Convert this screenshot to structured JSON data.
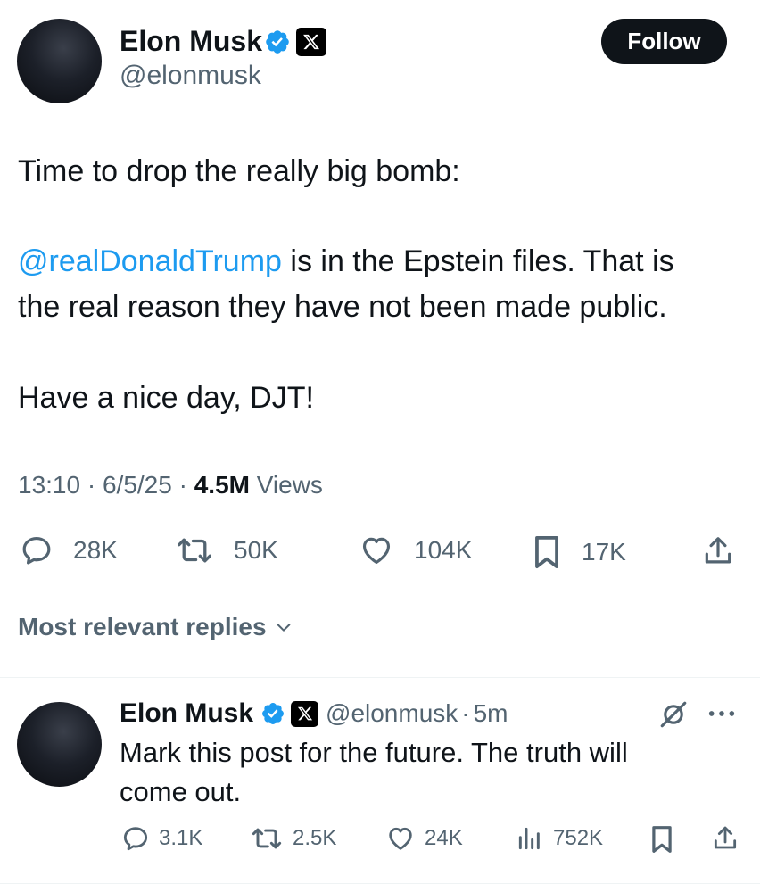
{
  "main_post": {
    "author_name": "Elon Musk",
    "author_handle": "@elonmusk",
    "follow_label": "Follow",
    "text_line_1": "Time to drop the really big bomb:",
    "mention": "@realDonaldTrump",
    "text_line_2_rest": " is in the Epstein files. That is",
    "text_line_3": "the real reason they have not been made public.",
    "text_line_4": "Have a nice day, DJT!",
    "time": "13:10",
    "sep_1": "·",
    "date": "6/5/25",
    "sep_2": "·",
    "views_count": "4.5M",
    "views_label": "Views",
    "replies": "28K",
    "reposts": "50K",
    "likes": "104K",
    "bookmarks": "17K"
  },
  "replies_section": {
    "sort_label": "Most relevant replies"
  },
  "reply": {
    "author_name": "Elon Musk",
    "author_handle": "@elonmusk",
    "sep": "·",
    "age": "5m",
    "text_line_1": "Mark this post for the future. The truth will",
    "text_line_2": "come out.",
    "replies": "3.1K",
    "reposts": "2.5K",
    "likes": "24K",
    "views": "752K"
  },
  "icons": {
    "verified": "verified-badge-icon",
    "x_logo": "x-logo-icon",
    "reply": "reply-icon",
    "repost": "repost-icon",
    "like": "like-icon",
    "bookmark": "bookmark-icon",
    "share": "share-icon",
    "views": "views-icon",
    "grok": "grok-icon",
    "more": "more-icon",
    "chevron": "chevron-down-icon"
  },
  "colors": {
    "accent": "#1d9bf0",
    "text": "#0f1419",
    "muted": "#536471"
  }
}
